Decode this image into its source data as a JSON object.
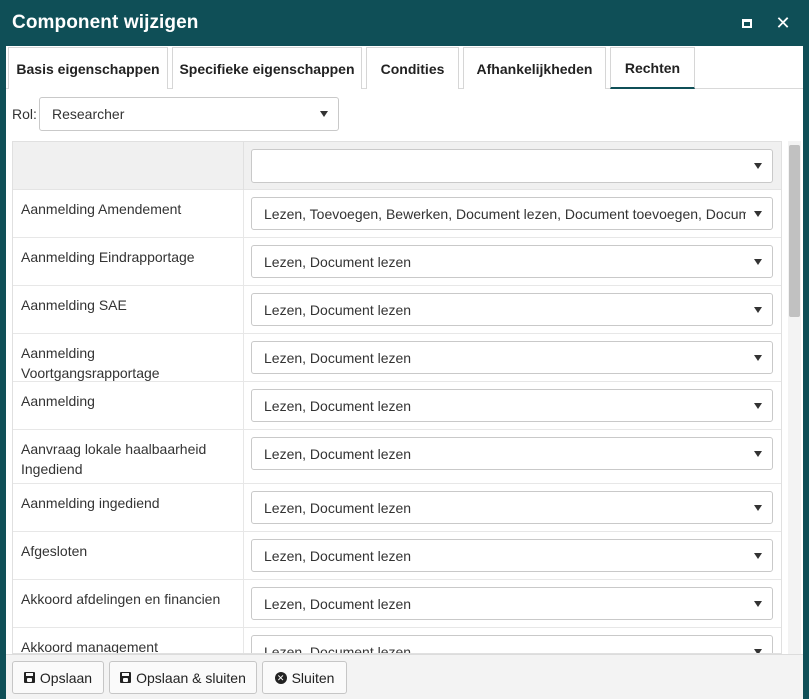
{
  "window": {
    "title": "Component wijzigen"
  },
  "tabs": [
    {
      "label": "Basis eigenschappen",
      "active": false
    },
    {
      "label": "Specifieke eigenschappen",
      "active": false
    },
    {
      "label": "Condities",
      "active": false
    },
    {
      "label": "Afhankelijkheden",
      "active": false
    },
    {
      "label": "Rechten",
      "active": true
    }
  ],
  "role": {
    "label": "Rol:",
    "value": "Researcher"
  },
  "grid": {
    "header_filter_value": "",
    "rows": [
      {
        "status": "Aanmelding Amendement",
        "rights": "Lezen, Toevoegen, Bewerken, Document lezen, Document toevoegen, Document bewerken"
      },
      {
        "status": "Aanmelding Eindrapportage",
        "rights": "Lezen, Document lezen"
      },
      {
        "status": "Aanmelding SAE",
        "rights": "Lezen, Document lezen"
      },
      {
        "status": "Aanmelding Voortgangsrapportage",
        "rights": "Lezen, Document lezen"
      },
      {
        "status": "Aanmelding",
        "rights": "Lezen, Document lezen"
      },
      {
        "status": "Aanvraag lokale haalbaarheid Ingediend",
        "rights": "Lezen, Document lezen"
      },
      {
        "status": "Aanmelding ingediend",
        "rights": "Lezen, Document lezen"
      },
      {
        "status": "Afgesloten",
        "rights": "Lezen, Document lezen"
      },
      {
        "status": "Akkoord afdelingen en financien",
        "rights": "Lezen, Document lezen"
      },
      {
        "status": "Akkoord management",
        "rights": "Lezen, Document lezen"
      }
    ]
  },
  "footer": {
    "save_label": "Opslaan",
    "save_close_label": "Opslaan & sluiten",
    "close_label": "Sluiten"
  },
  "icons": {
    "maximize": "maximize-icon",
    "close": "close-icon",
    "save": "floppy-disk-icon",
    "cancel": "x-circle-icon",
    "dropdown": "caret-down-icon"
  },
  "colors": {
    "titlebar": "#0f4f57",
    "active_tab_underline": "#0f4f57"
  }
}
